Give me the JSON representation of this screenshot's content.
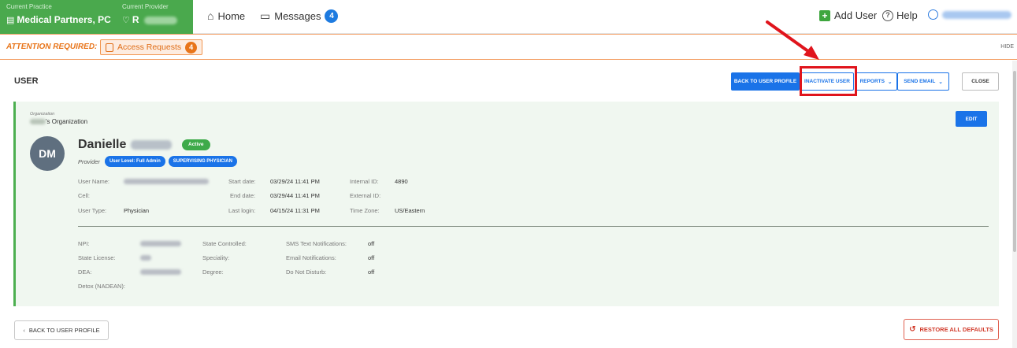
{
  "topbar": {
    "practice_label": "Current Practice",
    "practice_name": "Medical Partners, PC",
    "provider_label": "Current Provider",
    "provider_initial": "R",
    "home_label": "Home",
    "messages_label": "Messages",
    "messages_count": "4",
    "add_user_label": "Add User",
    "help_label": "Help",
    "user_dropdown_icon": "chevron-down-icon"
  },
  "attention": {
    "label": "ATTENTION REQUIRED:",
    "access_requests_label": "Access Requests",
    "access_requests_count": "4",
    "hide_label": "HIDE"
  },
  "header": {
    "title": "USER",
    "back_to_profile": "BACK TO USER PROFILE",
    "inactivate": "INACTIVATE USER",
    "reports": "REPORTS",
    "send_email": "SEND EMAIL",
    "close": "CLOSE"
  },
  "profile": {
    "org_label": "Organization",
    "org_name_suffix": "'s Organization",
    "edit_label": "EDIT",
    "initials": "DM",
    "first_name": "Danielle",
    "status": "Active",
    "role": "Provider",
    "badges": [
      "User Level: Full Admin",
      "SUPERVISING PHYSICIAN"
    ],
    "fields": {
      "user_name_label": "User Name:",
      "cell_label": "Cell:",
      "user_type_label": "User Type:",
      "user_type": "Physician",
      "start_date_label": "Start date:",
      "start_date": "03/29/24 11:41 PM",
      "end_date_label": "End date:",
      "end_date": "03/29/44 11:41 PM",
      "last_login_label": "Last login:",
      "last_login": "04/15/24 11:31 PM",
      "internal_id_label": "Internal ID:",
      "internal_id": "4890",
      "external_id_label": "External ID:",
      "time_zone_label": "Time Zone:",
      "time_zone": "US/Eastern"
    },
    "credentials": {
      "npi_label": "NPI:",
      "state_license_label": "State License:",
      "dea_label": "DEA:",
      "detox_label": "Detox (NADEAN):",
      "state_controlled_label": "State Controlled:",
      "speciality_label": "Speciality:",
      "degree_label": "Degree:",
      "sms_label": "SMS Text Notifications:",
      "sms_value": "off",
      "email_notif_label": "Email Notifications:",
      "email_notif_value": "off",
      "dnd_label": "Do Not Disturb:",
      "dnd_value": "off"
    }
  },
  "footer": {
    "back_label": "BACK TO USER PROFILE",
    "restore_label": "RESTORE ALL DEFAULTS"
  },
  "colors": {
    "brand_green": "#4aa94d",
    "primary_blue": "#1a73e8",
    "attention_orange": "#e8751a",
    "highlight_red": "#e0141c"
  }
}
